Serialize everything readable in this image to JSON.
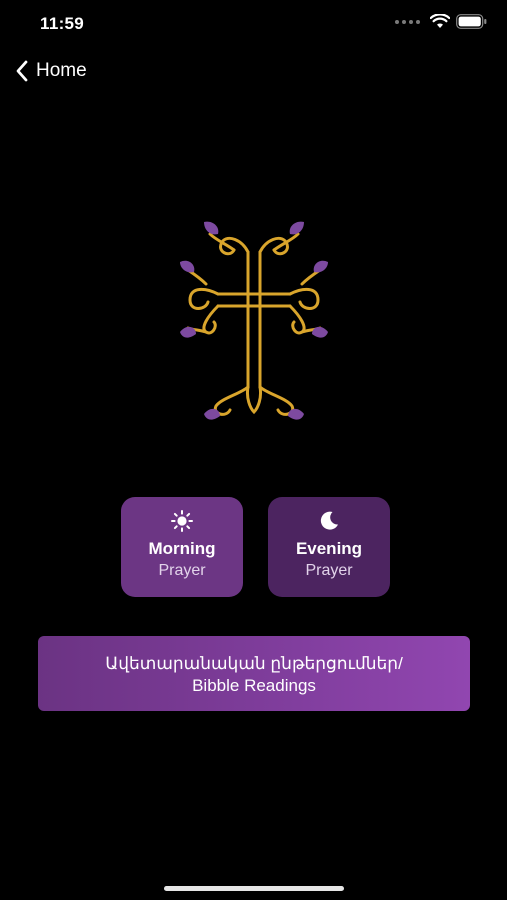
{
  "status_bar": {
    "time": "11:59",
    "icons": [
      "signal-icon",
      "wifi-icon",
      "battery-icon"
    ]
  },
  "nav": {
    "back_label": "Home"
  },
  "emblem": {
    "name": "armenian-cross-icon",
    "colors": {
      "gold": "#d9a52c",
      "purple": "#7d4aa0"
    }
  },
  "prayers": {
    "morning": {
      "title": "Morning",
      "subtitle": "Prayer",
      "icon": "sun-icon",
      "color": "#6c3684"
    },
    "evening": {
      "title": "Evening",
      "subtitle": "Prayer",
      "icon": "moon-icon",
      "color": "#4c2460"
    }
  },
  "readings": {
    "line1": "Ավետարանական ընթերցումներ/",
    "line2": "Bibble Readings"
  }
}
